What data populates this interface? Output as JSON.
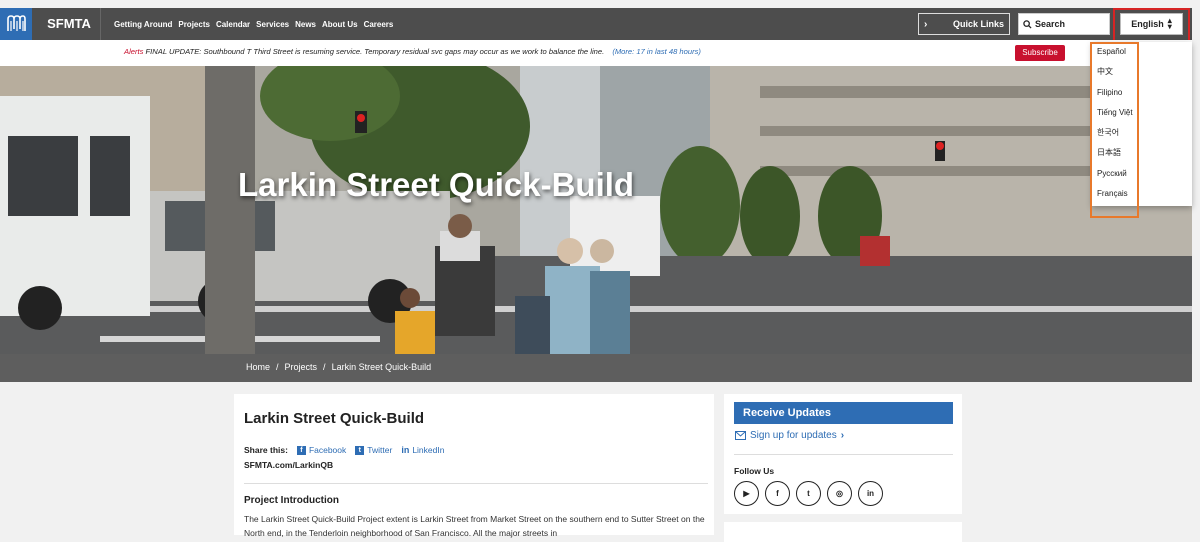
{
  "header": {
    "brand": "SFMTA",
    "nav": [
      "Getting Around",
      "Projects",
      "Calendar",
      "Services",
      "News",
      "About Us",
      "Careers"
    ],
    "quick_links": "Quick Links",
    "search_placeholder": "Search",
    "language": "English"
  },
  "alert": {
    "label": "Alerts",
    "text": "FINAL UPDATE: Southbound T Third Street is resuming service. Temporary residual svc gaps may occur as we work to balance the line.",
    "more": "(More: 17 in last 48 hours)",
    "subscribe": "Subscribe"
  },
  "hero": {
    "title": "Larkin Street Quick-Build"
  },
  "breadcrumb": [
    "Home",
    "/",
    "Projects",
    "/",
    "Larkin Street Quick-Build"
  ],
  "main": {
    "title": "Larkin Street Quick-Build",
    "share_label": "Share this:",
    "share_links": [
      "Facebook",
      "Twitter",
      "LinkedIn"
    ],
    "short_url": "SFMTA.com/LarkinQB",
    "intro_heading": "Project Introduction",
    "intro_text": "The Larkin Street Quick-Build Project extent is Larkin Street from Market Street on the southern end to Sutter Street on the North end, in the Tenderloin neighborhood of San Francisco. All the major streets in"
  },
  "sidebar": {
    "receive_updates": "Receive Updates",
    "signup": "Sign up for updates",
    "follow_us": "Follow Us",
    "socials": [
      "youtube-icon",
      "facebook-icon",
      "twitter-icon",
      "instagram-icon",
      "linkedin-icon"
    ]
  },
  "language_menu": [
    "Español",
    "中文",
    "Filipino",
    "Tiếng Việt",
    "한국어",
    "日本語",
    "Русский",
    "Français"
  ],
  "colors": {
    "brand_blue": "#2e6db4",
    "header_gray": "#4d4d4d",
    "alert_red": "#c8102e",
    "highlight_red": "#d62424",
    "highlight_orange": "#e8792b"
  }
}
